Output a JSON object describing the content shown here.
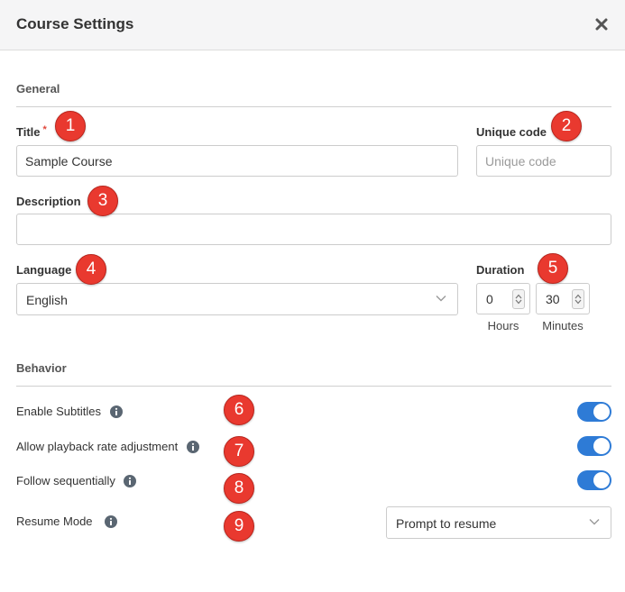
{
  "header": {
    "title": "Course Settings"
  },
  "general": {
    "section_title": "General",
    "title_label": "Title",
    "title_required_mark": "*",
    "title_value": "Sample Course",
    "unique_code_label": "Unique code",
    "unique_code_placeholder": "Unique code",
    "description_label": "Description",
    "description_value": "",
    "language_label": "Language",
    "language_value": "English",
    "duration_label": "Duration",
    "hours_value": "0",
    "hours_label": "Hours",
    "minutes_value": "30",
    "minutes_label": "Minutes"
  },
  "behavior": {
    "section_title": "Behavior",
    "enable_subtitles_label": "Enable Subtitles",
    "enable_subtitles_on": true,
    "playback_rate_label": "Allow playback rate adjustment",
    "playback_rate_on": true,
    "follow_sequentially_label": "Follow sequentially",
    "follow_sequentially_on": true,
    "resume_mode_label": "Resume Mode",
    "resume_mode_value": "Prompt to resume"
  },
  "annotations": [
    "1",
    "2",
    "3",
    "4",
    "5",
    "6",
    "7",
    "8",
    "9"
  ],
  "colors": {
    "accent": "#2e7bd6",
    "badge": "#e9392f",
    "required": "#e0463a"
  }
}
